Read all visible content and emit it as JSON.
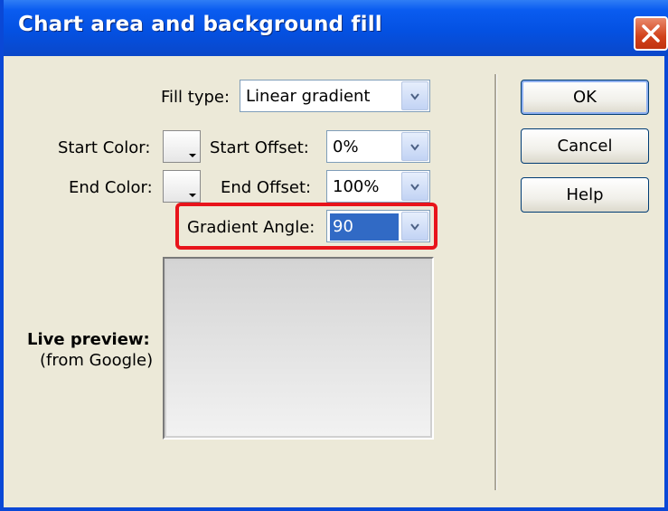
{
  "window": {
    "title": "Chart area and background fill"
  },
  "fill_type": {
    "label": "Fill type:",
    "value": "Linear gradient"
  },
  "start_color": {
    "label": "Start Color:"
  },
  "start_offset": {
    "label": "Start Offset:",
    "value": "0%"
  },
  "end_color": {
    "label": "End Color:"
  },
  "end_offset": {
    "label": "End Offset:",
    "value": "100%"
  },
  "gradient_angle": {
    "label": "Gradient Angle:",
    "value": "90"
  },
  "live_preview": {
    "label": "Live preview:",
    "sublabel": "(from Google)"
  },
  "buttons": {
    "ok": "OK",
    "cancel": "Cancel",
    "help": "Help"
  },
  "colors": {
    "titlebar": "#0451e2",
    "highlight": "#e8141b",
    "selection": "#316ac5",
    "close": "#d2421b"
  },
  "icons": {
    "close": "close-icon",
    "dropdown": "chevron-down-icon"
  }
}
